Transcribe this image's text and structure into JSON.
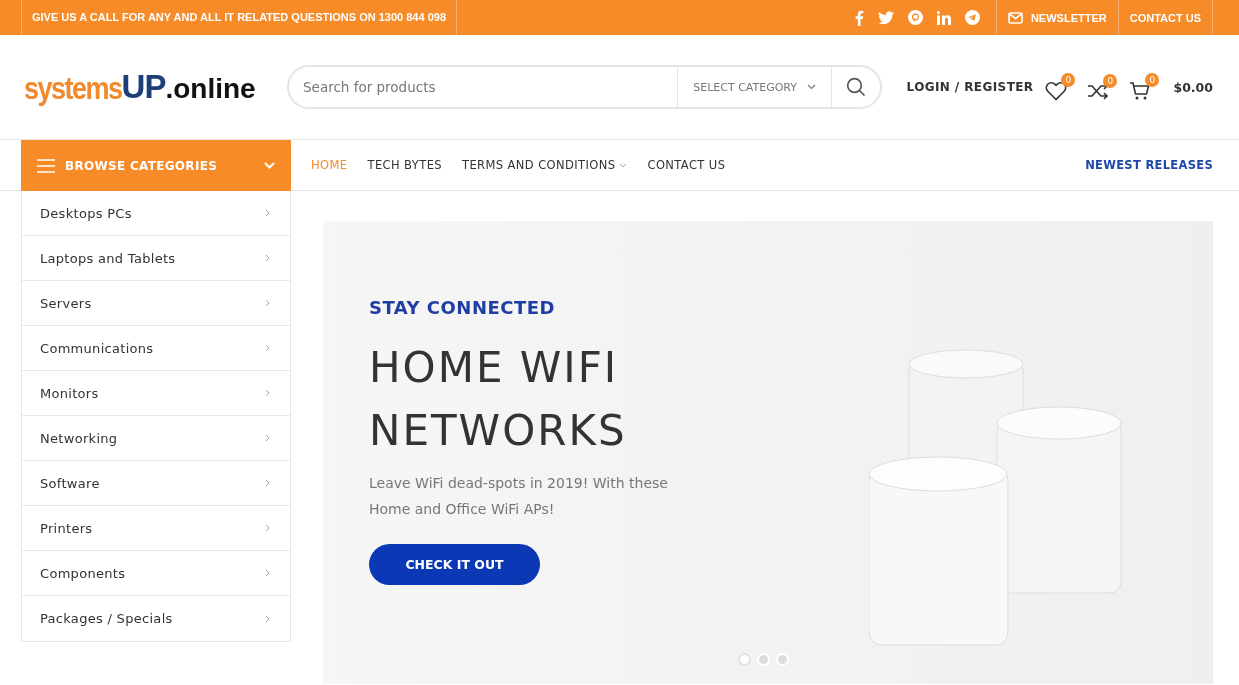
{
  "top_bar": {
    "message": "GIVE US A CALL FOR ANY AND ALL IT RELATED QUESTIONS ON 1300 844 098",
    "links": [
      "NEWSLETTER",
      "CONTACT US"
    ]
  },
  "logo": {
    "part_1": "systems",
    "part_2": "UP",
    "part_3": ".online"
  },
  "search": {
    "placeholder": "Search for products",
    "category": "SELECT CATEGORY"
  },
  "account": {
    "login": "LOGIN / REGISTER",
    "wishlist_count": "0",
    "compare_count": "0",
    "cart_count": "0",
    "cart_total": "$0.00"
  },
  "categories": {
    "title": "BROWSE CATEGORIES",
    "items": [
      "Desktops PCs",
      "Laptops and Tablets",
      "Servers",
      "Communications",
      "Monitors",
      "Networking",
      "Software",
      "Printers",
      "Components",
      "Packages / Specials"
    ]
  },
  "nav": [
    {
      "label": "HOME",
      "selected": true,
      "dropdown": false
    },
    {
      "label": "TECH BYTES",
      "selected": false,
      "dropdown": false
    },
    {
      "label": "TERMS AND CONDITIONS",
      "selected": false,
      "dropdown": true
    },
    {
      "label": "CONTACT US",
      "selected": false,
      "dropdown": false
    }
  ],
  "nav_right": "NEWEST RELEASES",
  "hero": {
    "eyebrow": "STAY CONNECTED",
    "title_lines": [
      "HOME WIFI",
      "NETWORKS"
    ],
    "text": "Leave WiFi dead-spots in 2019! With these Home and Office WiFi APs!",
    "button": "CHECK IT OUT",
    "dots": [
      {
        "selected": true
      },
      {
        "selected": false
      },
      {
        "selected": false
      }
    ]
  }
}
